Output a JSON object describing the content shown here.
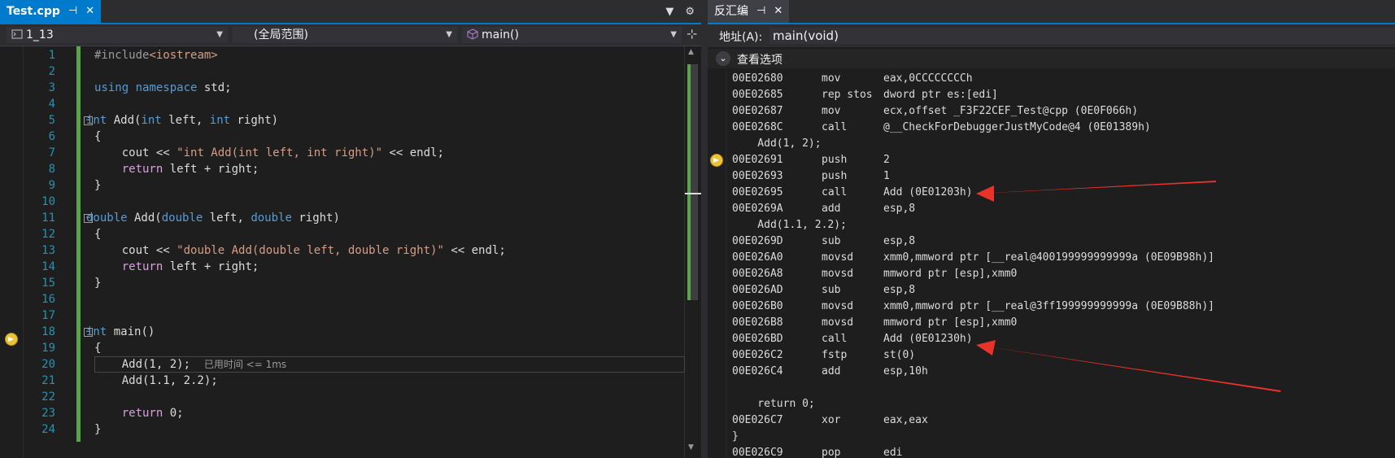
{
  "editor_tab": {
    "title": "Test.cpp",
    "pin_icon": "pin-icon",
    "close_icon": "close-icon"
  },
  "editor_toolbar": {
    "dropdown_glyph": "▼",
    "gear_glyph": "⚙"
  },
  "nav": {
    "project": "1_13",
    "scope": "(全局范围)",
    "member": "main()"
  },
  "code_lines": [
    {
      "n": "1",
      "html": "<span class='pp'>#include</span><span class='inc'>&lt;iostream&gt;</span>"
    },
    {
      "n": "2",
      "html": ""
    },
    {
      "n": "3",
      "html": "<span class='kw'>using</span> <span class='kw'>namespace</span> std;"
    },
    {
      "n": "4",
      "html": ""
    },
    {
      "n": "5",
      "html": "<span class='kw'>int</span> Add(<span class='kw'>int</span> left, <span class='kw'>int</span> right)",
      "fold": true,
      "shift": -10
    },
    {
      "n": "6",
      "html": "{"
    },
    {
      "n": "7",
      "html": "    cout &lt;&lt; <span class='str'>\"int Add(int left, int right)\"</span> &lt;&lt; endl;"
    },
    {
      "n": "8",
      "html": "    <span class='kw2'>return</span> left + right;"
    },
    {
      "n": "9",
      "html": "}"
    },
    {
      "n": "10",
      "html": ""
    },
    {
      "n": "11",
      "html": "<span class='kw'>double</span> Add(<span class='kw'>double</span> left, <span class='kw'>double</span> right)",
      "fold": true,
      "shift": -10
    },
    {
      "n": "12",
      "html": "{"
    },
    {
      "n": "13",
      "html": "    cout &lt;&lt; <span class='str'>\"double Add(double left, double right)\"</span> &lt;&lt; endl;"
    },
    {
      "n": "14",
      "html": "    <span class='kw2'>return</span> left + right;"
    },
    {
      "n": "15",
      "html": "}"
    },
    {
      "n": "16",
      "html": ""
    },
    {
      "n": "17",
      "html": ""
    },
    {
      "n": "18",
      "html": "<span class='kw'>int</span> main()",
      "fold": true,
      "shift": -10
    },
    {
      "n": "19",
      "html": "{"
    },
    {
      "n": "20",
      "html": "    Add(1, 2);  <span class='elapsed'>已用时间 &lt;= 1ms</span>",
      "current": true
    },
    {
      "n": "21",
      "html": "    Add(1.1, 2.2);"
    },
    {
      "n": "22",
      "html": ""
    },
    {
      "n": "23",
      "html": "    <span class='kw2'>return</span> 0;"
    },
    {
      "n": "24",
      "html": "}"
    }
  ],
  "disasm_tab": {
    "title": "反汇编",
    "pin_icon": "pin-icon",
    "close_icon": "close-icon"
  },
  "address": {
    "label": "地址(A):",
    "value": "main(void)"
  },
  "view_options": {
    "label": "查看选项",
    "chevron": "⌄"
  },
  "disasm_rows": [
    {
      "a": "00E02680",
      "m": "mov",
      "o": "eax,0CCCCCCCCh"
    },
    {
      "a": "00E02685",
      "m": "rep stos",
      "o": "dword ptr es:[edi]"
    },
    {
      "a": "00E02687",
      "m": "mov",
      "o": "ecx,offset _F3F22CEF_Test@cpp (0E0F066h)"
    },
    {
      "a": "00E0268C",
      "m": "call",
      "o": "@__CheckForDebuggerJustMyCode@4 (0E01389h)"
    },
    {
      "src": "    Add(1, 2);"
    },
    {
      "a": "00E02691",
      "m": "push",
      "o": "2",
      "current": true
    },
    {
      "a": "00E02693",
      "m": "push",
      "o": "1"
    },
    {
      "a": "00E02695",
      "m": "call",
      "o": "Add (0E01203h)"
    },
    {
      "a": "00E0269A",
      "m": "add",
      "o": "esp,8"
    },
    {
      "src": "    Add(1.1, 2.2);"
    },
    {
      "a": "00E0269D",
      "m": "sub",
      "o": "esp,8"
    },
    {
      "a": "00E026A0",
      "m": "movsd",
      "o": "xmm0,mmword ptr [__real@400199999999999a (0E09B98h)]"
    },
    {
      "a": "00E026A8",
      "m": "movsd",
      "o": "mmword ptr [esp],xmm0"
    },
    {
      "a": "00E026AD",
      "m": "sub",
      "o": "esp,8"
    },
    {
      "a": "00E026B0",
      "m": "movsd",
      "o": "xmm0,mmword ptr [__real@3ff199999999999a (0E09B88h)]"
    },
    {
      "a": "00E026B8",
      "m": "movsd",
      "o": "mmword ptr [esp],xmm0"
    },
    {
      "a": "00E026BD",
      "m": "call",
      "o": "Add (0E01230h)"
    },
    {
      "a": "00E026C2",
      "m": "fstp",
      "o": "st(0)"
    },
    {
      "a": "00E026C4",
      "m": "add",
      "o": "esp,10h"
    },
    {
      "src": ""
    },
    {
      "src": "    return 0;"
    },
    {
      "a": "00E026C7",
      "m": "xor",
      "o": "eax,eax"
    },
    {
      "src": "}"
    },
    {
      "a": "00E026C9",
      "m": "pop",
      "o": "edi"
    }
  ],
  "colors": {
    "accent": "#007acc",
    "annotation": "#e8322a",
    "line_numbers": "#2b91af"
  }
}
